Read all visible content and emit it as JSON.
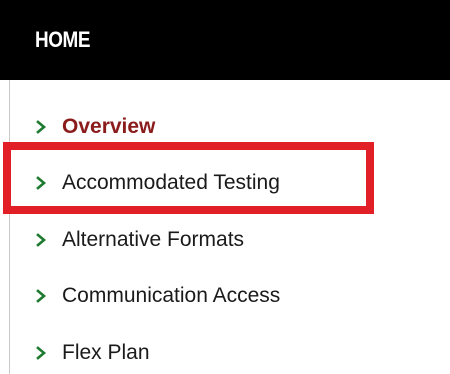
{
  "header": {
    "title": "HOME"
  },
  "nav": {
    "items": [
      {
        "label": "Overview",
        "icon": "chevron-right-icon",
        "active": true
      },
      {
        "label": "Accommodated Testing",
        "icon": "chevron-right-icon",
        "active": false
      },
      {
        "label": "Alternative Formats",
        "icon": "chevron-right-icon",
        "active": false
      },
      {
        "label": "Communication Access",
        "icon": "chevron-right-icon",
        "active": false
      },
      {
        "label": "Flex Plan",
        "icon": "chevron-right-icon",
        "active": false
      }
    ]
  },
  "colors": {
    "header_background": "#000000",
    "header_text": "#ffffff",
    "chevron": "#1e7a2e",
    "active_link": "#8b1c1c",
    "link": "#1a1a1a",
    "highlight_border": "#e21e26"
  }
}
